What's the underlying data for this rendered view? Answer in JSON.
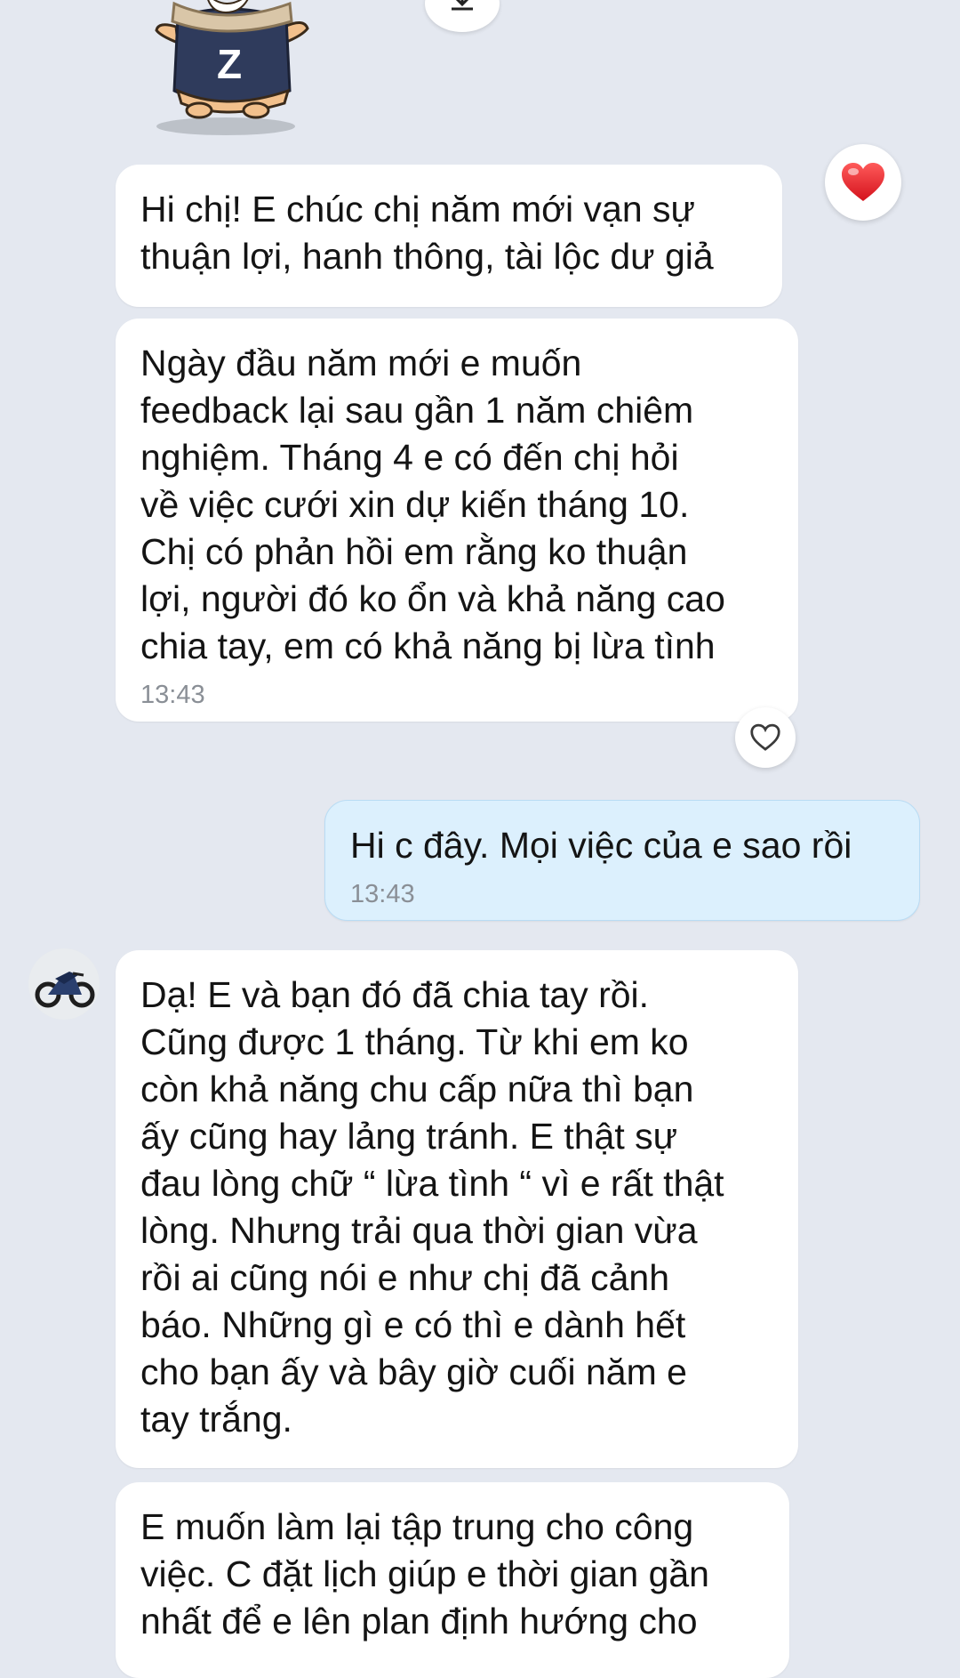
{
  "sticker": {
    "shirt_letter": "Z",
    "icon": "hamster-sticker"
  },
  "download": {
    "icon": "download-icon"
  },
  "messages": [
    {
      "side": "received",
      "text": "Hi chị! E chúc chị năm mới vạn sự\nthuận lợi, hanh thông, tài lộc dư giả",
      "reaction": "heart-filled-icon"
    },
    {
      "side": "received",
      "text": "Ngày đầu năm mới e muốn\nfeedback lại sau gần 1 năm chiêm\nnghiệm. Tháng 4 e có đến chị hỏi\nvề việc cưới xin dự kiến tháng 10.\nChị có phản hồi em rằng ko thuận\nlợi, người đó ko ổn và khả năng cao\nchia tay, em có khả năng bị lừa tình",
      "time": "13:43",
      "reaction": "heart-outline-icon"
    },
    {
      "side": "sent",
      "text": "Hi c đây. Mọi việc của e sao rồi",
      "time": "13:43"
    },
    {
      "side": "received",
      "text": "Dạ! E và bạn đó đã chia tay rồi.\nCũng được 1 tháng. Từ khi em ko\ncòn khả năng chu cấp nữa thì bạn\nấy cũng hay lảng tránh. E thật sự\nđau lòng chữ “ lừa tình “ vì e rất thật\nlòng. Nhưng trải qua thời gian vừa\nrồi ai cũng nói e như chị đã cảnh\nbáo. Những gì e có thì e dành hết\ncho bạn ấy và bây giờ cuối năm e\ntay trắng.",
      "avatar": "motorcycle-avatar"
    },
    {
      "side": "received",
      "text": "E muốn làm lại tập trung cho công\nviệc. C đặt lịch giúp e thời gian gần\nnhất để e lên plan định hướng cho"
    }
  ],
  "colors": {
    "background": "#e4e8f0",
    "received_bubble": "#ffffff",
    "sent_bubble": "#dcf0fd",
    "text": "#141414",
    "timestamp": "#8a8f96",
    "heart": "#e8202a"
  }
}
